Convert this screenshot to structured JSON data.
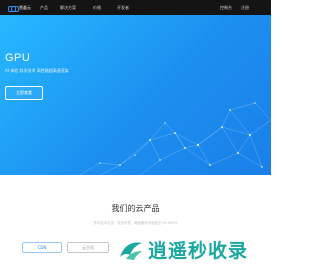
{
  "navbar": {
    "brand_text": "慧鑫云",
    "items": [
      "产品",
      "解决方案",
      "价格",
      "开发者"
    ],
    "right_items": [
      "控制台",
      "注册"
    ]
  },
  "hero": {
    "title": "GPU",
    "subtitle": "AI 体验 科学技术 高性能超高速渲染",
    "button_label": "立即查看"
  },
  "products": {
    "title": "我们的云产品",
    "subtitle": "多年技术沉淀，安全可靠，确保服务可用性达 99.999%",
    "tabs": [
      "CDN",
      "云主机"
    ]
  },
  "watermark": {
    "text": "逍遥秒收录"
  },
  "colors": {
    "navbar_bg": "#141414",
    "hero_gradient_start": "#26b9ff",
    "hero_gradient_end": "#1a7fe8",
    "accent": "#2f8cf5",
    "watermark_teal": "#1aa7a0"
  }
}
